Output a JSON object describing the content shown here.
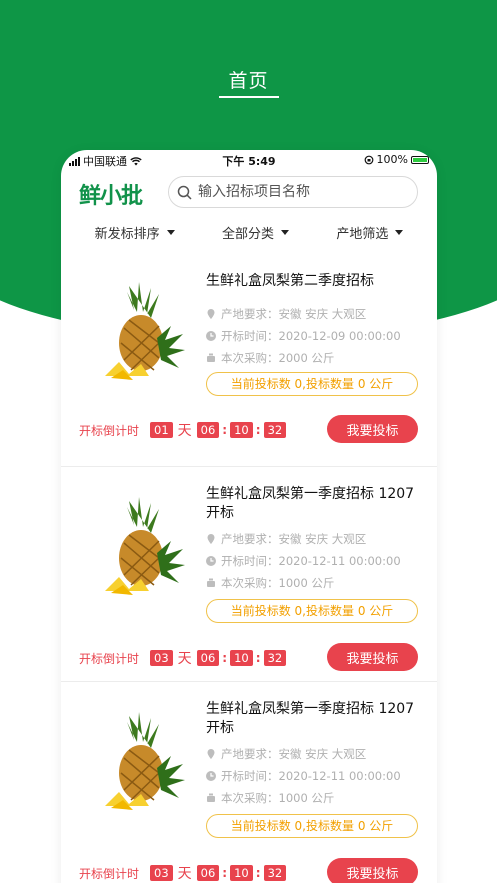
{
  "page": {
    "title": "首页"
  },
  "statusbar": {
    "carrier": "中国联通",
    "time": "下午 5:49",
    "battery": "100%"
  },
  "header": {
    "logo": "鲜小批",
    "search_placeholder": "输入招标项目名称"
  },
  "filters": [
    {
      "label": "新发标排序"
    },
    {
      "label": "全部分类"
    },
    {
      "label": "产地筛选"
    }
  ],
  "cards": [
    {
      "title": "生鲜礼盒凤梨第二季度招标",
      "origin": "产地要求：安徽 安庆 大观区",
      "open_time": "开标时间：2020-12-09 00:00:00",
      "purchase": "本次采购：2000 公斤",
      "bid_status": "当前投标数 0,投标数量 0 公斤",
      "countdown_label": "开标倒计时",
      "days": "01",
      "day_unit": "天",
      "hours": "06",
      "minutes": "10",
      "seconds": "32",
      "bid_button": "我要投标"
    },
    {
      "title": "生鲜礼盒凤梨第一季度招标 1207 开标",
      "origin": "产地要求：安徽 安庆 大观区",
      "open_time": "开标时间：2020-12-11 00:00:00",
      "purchase": "本次采购：1000 公斤",
      "bid_status": "当前投标数 0,投标数量 0 公斤",
      "countdown_label": "开标倒计时",
      "days": "03",
      "day_unit": "天",
      "hours": "06",
      "minutes": "10",
      "seconds": "32",
      "bid_button": "我要投标"
    },
    {
      "title": "生鲜礼盒凤梨第一季度招标 1207 开标",
      "origin": "产地要求：安徽 安庆 大观区",
      "open_time": "开标时间：2020-12-11 00:00:00",
      "purchase": "本次采购：1000 公斤",
      "bid_status": "当前投标数 0,投标数量 0 公斤",
      "countdown_label": "开标倒计时",
      "days": "03",
      "day_unit": "天",
      "hours": "06",
      "minutes": "10",
      "seconds": "32",
      "bid_button": "我要投标"
    }
  ],
  "colors": {
    "brand_green": "#0e9646",
    "accent_red": "#e8434d",
    "accent_orange": "#f2a000"
  }
}
